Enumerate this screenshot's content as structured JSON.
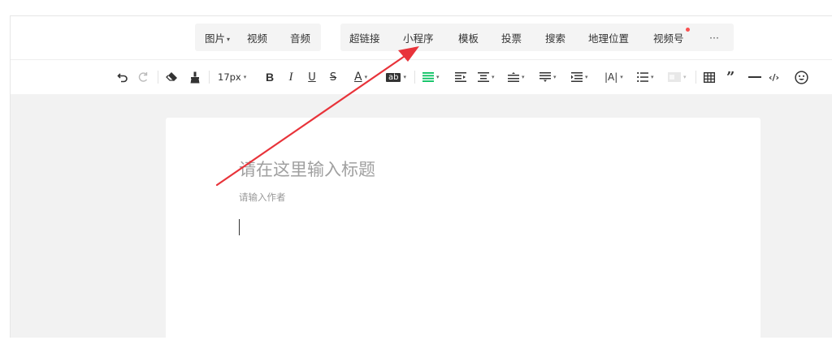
{
  "insert_bar": {
    "media_group": [
      {
        "label": "图片",
        "has_dropdown": true
      },
      {
        "label": "视频",
        "has_dropdown": false
      },
      {
        "label": "音频",
        "has_dropdown": false
      }
    ],
    "content_group": [
      {
        "label": "超链接"
      },
      {
        "label": "小程序"
      },
      {
        "label": "模板"
      },
      {
        "label": "投票"
      },
      {
        "label": "搜索"
      },
      {
        "label": "地理位置"
      },
      {
        "label": "视频号",
        "notification_dot": true
      },
      {
        "label": "···"
      }
    ]
  },
  "format_toolbar": {
    "undo_icon": "undo-icon",
    "redo_icon": "redo-icon",
    "font_size": "17px",
    "bold": "B",
    "italic": "I",
    "underline": "U",
    "strike": "S",
    "font_color": "A",
    "highlight": "ab",
    "accent_color": "#07c160"
  },
  "editor": {
    "title_placeholder": "请在这里输入标题",
    "author_placeholder": "请输入作者"
  },
  "annotation": {
    "arrow_color": "#e8333a"
  }
}
